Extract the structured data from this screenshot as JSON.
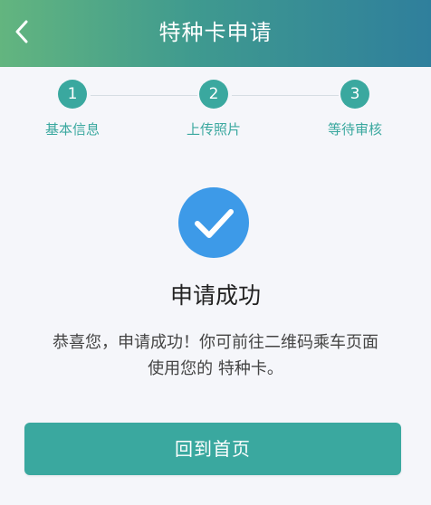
{
  "header": {
    "title": "特种卡申请",
    "back_icon": "chevron-left-icon"
  },
  "steps": [
    {
      "number": "1",
      "label": "基本信息"
    },
    {
      "number": "2",
      "label": "上传照片"
    },
    {
      "number": "3",
      "label": "等待审核"
    }
  ],
  "success": {
    "icon": "check-circle-icon",
    "title": "申请成功",
    "message_line1": "恭喜您，申请成功！你可前往二维码乘车页面",
    "message_line2": "使用您的 特种卡。"
  },
  "actions": {
    "home_label": "回到首页"
  },
  "colors": {
    "accent": "#3aa89f",
    "success_icon": "#3d9ae8",
    "header_start": "#63b57f",
    "header_end": "#2f7f9c",
    "background": "#f5f6fa"
  }
}
